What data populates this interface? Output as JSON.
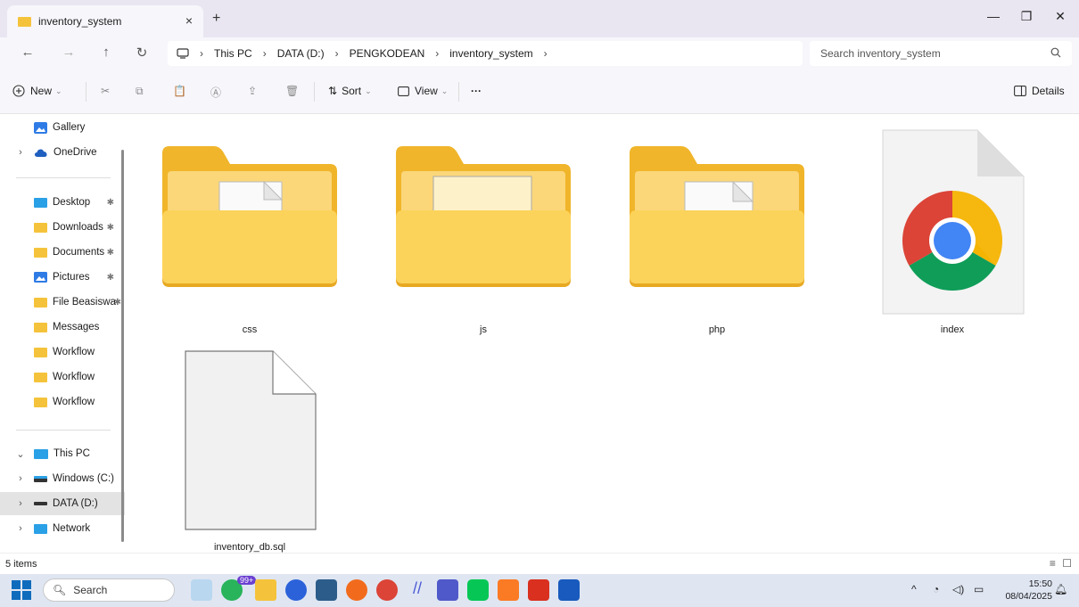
{
  "window": {
    "tab_title": "inventory_system",
    "tab_close": "×",
    "new_tab": "+",
    "minimize": "—",
    "restore": "❐",
    "close": "✕"
  },
  "nav_buttons": {
    "back": "←",
    "forward": "→",
    "up": "↑",
    "refresh": "↻"
  },
  "breadcrumb": [
    "This PC",
    "DATA (D:)",
    "PENGKODEAN",
    "inventory_system"
  ],
  "search": {
    "placeholder": "Search inventory_system"
  },
  "commands": {
    "new": "New",
    "sort": "Sort",
    "view": "View",
    "more": "···",
    "details": "Details"
  },
  "sidebar": {
    "top": [
      {
        "label": "Gallery",
        "icon": "gallery-icon"
      },
      {
        "label": "OneDrive",
        "icon": "onedrive-icon"
      }
    ],
    "quick": [
      {
        "label": "Desktop",
        "icon": "desktop-icon"
      },
      {
        "label": "Downloads",
        "icon": "folder-icon"
      },
      {
        "label": "Documents",
        "icon": "folder-icon"
      },
      {
        "label": "Pictures",
        "icon": "pictures-icon"
      },
      {
        "label": "File Beasiswa",
        "icon": "folder-icon"
      },
      {
        "label": "Messages",
        "icon": "folder-icon"
      },
      {
        "label": "Workflow",
        "icon": "folder-icon"
      },
      {
        "label": "Workflow",
        "icon": "folder-icon"
      },
      {
        "label": "Workflow",
        "icon": "folder-icon"
      }
    ],
    "pc": [
      {
        "label": "This PC",
        "icon": "this-pc-icon"
      },
      {
        "label": "Windows (C:)",
        "icon": "drive-icon"
      },
      {
        "label": "DATA (D:)",
        "icon": "drive-icon"
      },
      {
        "label": "Network",
        "icon": "network-icon"
      }
    ]
  },
  "files": [
    {
      "name": "css",
      "kind": "folder"
    },
    {
      "name": "js",
      "kind": "folder"
    },
    {
      "name": "php",
      "kind": "folder"
    },
    {
      "name": "index",
      "kind": "html-chrome"
    },
    {
      "name": "inventory_db.sql",
      "kind": "file"
    }
  ],
  "status": {
    "count": "5 items"
  },
  "taskbar": {
    "search_label": "Search",
    "badge": "99+",
    "time": "15:50",
    "date": "08/04/2025"
  },
  "colors": {
    "folder": "#f5c33b",
    "accent": "#0067c0",
    "chrome_red": "#db4437",
    "chrome_yellow": "#f4b400",
    "chrome_green": "#0f9d58",
    "chrome_blue": "#4285f4"
  }
}
